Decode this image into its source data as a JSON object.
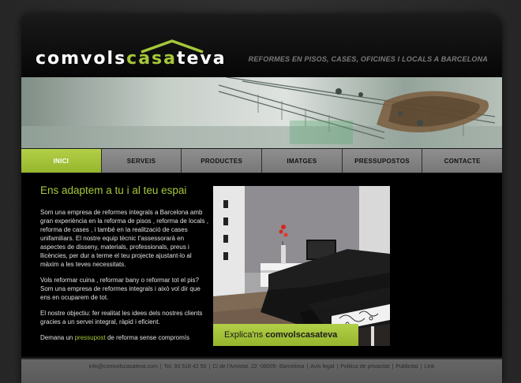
{
  "brand": {
    "logo_pre": "comvols",
    "logo_accent": "casa",
    "logo_post": "teva",
    "tagline": "REFORMES EN PISOS, CASES, OFICINES I LOCALS A BARCELONA",
    "accent_color": "#a6c73a"
  },
  "nav": {
    "items": [
      {
        "label": "INICI",
        "active": true
      },
      {
        "label": "SERVEIS"
      },
      {
        "label": "PRODUCTES"
      },
      {
        "label": "IMATGES"
      },
      {
        "label": "PRESSUPOSTOS"
      },
      {
        "label": "CONTACTE"
      }
    ]
  },
  "main": {
    "heading": "Ens adaptem a tu i al teu espai",
    "p1": "Som una empresa de reformes integrals a Barcelona amb gran experiència en la reforma de pisos , reforma de locals , reforma de cases , i també en la realització de cases unifamiliars. El nostre equip tècnic t'assessorarà en aspectes de disseny, materials, professionals, preus i llicències, per dur a terme el teu projecte ajustant-lo al màxim a les teves necessitats.",
    "p2": "Vols reformar cuina , reformar bany o reformar tot el pis? Som una empresa de reformes integrals i això vol dir que ens en ocuparem de tot.",
    "p3": "El nostre objectiu: fer realitat les idees dels nostres clients gracies a un servei integral, ràpid i eficient.",
    "p4_pre": "Demana un",
    "p4_link": "pressupost",
    "p4_post": "de reforma sense compromís",
    "cta_pre": "Explica'ns",
    "cta_bold": "comvolscasateva"
  },
  "footer": {
    "email": "info@comvolscasateva.com",
    "phone": "Tel. 93 518 42 50",
    "address": "C/ de l'Amistat, 22 -08005- Barcelona",
    "links": [
      "Avís legal",
      "Politica de privacitat",
      "Publicitat",
      "Link"
    ]
  }
}
